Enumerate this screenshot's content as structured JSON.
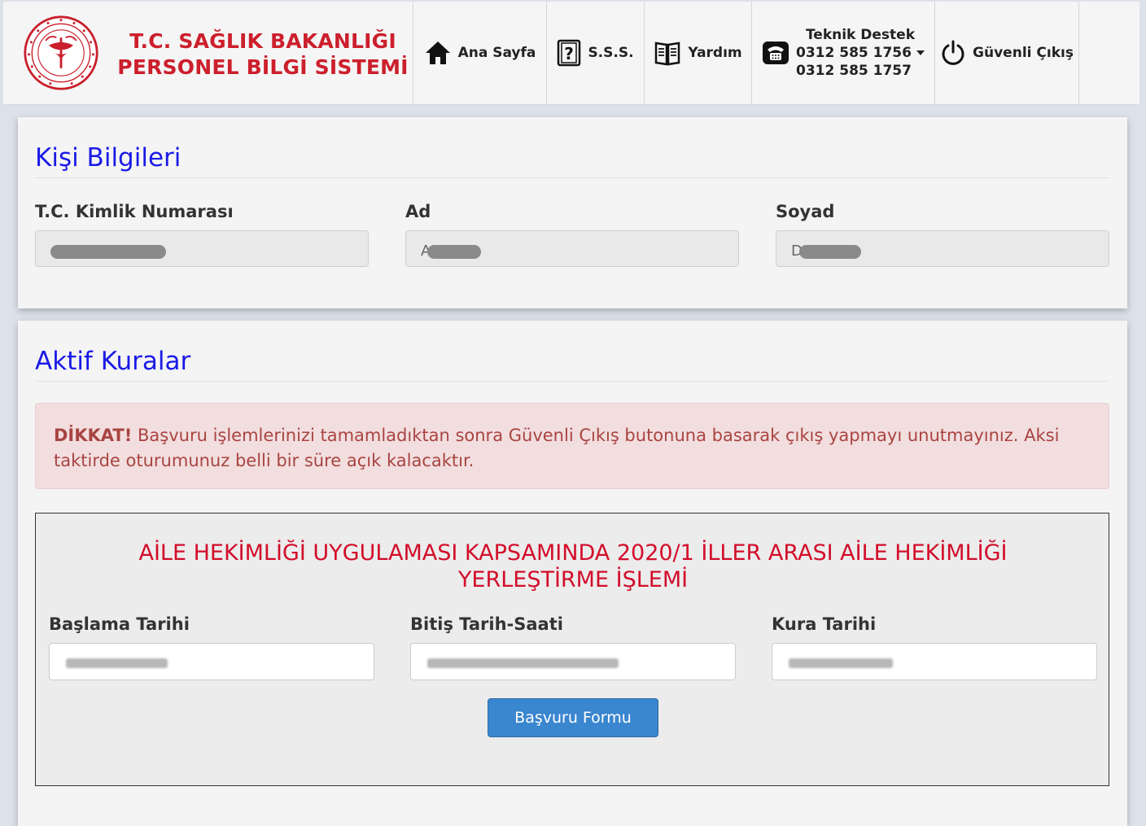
{
  "header": {
    "brand_line1": "T.C. SAĞLIK BAKANLIĞI",
    "brand_line2": "PERSONEL BİLGİ SİSTEMİ",
    "nav": {
      "home": "Ana Sayfa",
      "sss": "S.S.S.",
      "help": "Yardım",
      "tech_title": "Teknik Destek",
      "tech_phone1": "0312 585 1756",
      "tech_phone2": "0312 585 1757",
      "exit": "Güvenli Çıkış"
    }
  },
  "person": {
    "title": "Kişi Bilgileri",
    "tc_label": "T.C. Kimlik Numarası",
    "tc_value": "",
    "name_label": "Ad",
    "name_value": "A",
    "surname_label": "Soyad",
    "surname_value": "D"
  },
  "rules": {
    "title": "Aktif Kuralar",
    "alert_strong": "DİKKAT!",
    "alert_text": " Başvuru işlemlerinizi tamamladıktan sonra Güvenli Çıkış butonuna basarak çıkış yapmayı unutmayınız. Aksi taktirde oturumunuz belli bir süre açık kalacaktır.",
    "rule_title": "AİLE HEKİMLİĞİ UYGULAMASI KAPSAMINDA 2020/1 İLLER ARASI AİLE HEKİMLİĞİ YERLEŞTİRME İŞLEMİ",
    "start_label": "Başlama Tarihi",
    "end_label": "Bitiş Tarih-Saati",
    "draw_label": "Kura Tarihi",
    "apply_button": "Başvuru Formu"
  },
  "colors": {
    "brand_red": "#cc1f2c",
    "section_blue": "#1a1ae6",
    "rule_red": "#d20d2a",
    "button_blue": "#3a86cf"
  },
  "icons": {
    "logo": "ministry-seal-icon",
    "home": "home-icon",
    "sss": "question-icon",
    "help": "book-icon",
    "tech": "phone-icon",
    "exit": "power-icon"
  }
}
